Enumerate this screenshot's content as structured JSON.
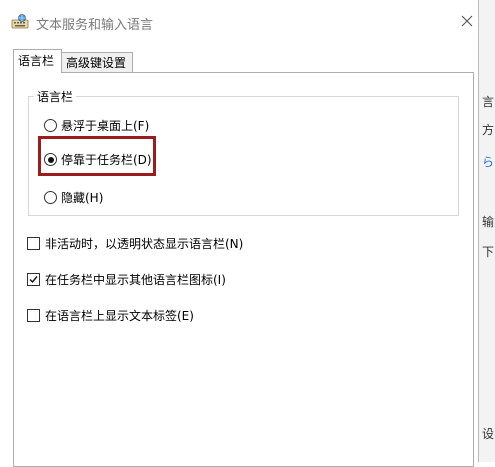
{
  "window": {
    "title": "文本服务和输入语言",
    "app_icon": "keyboard-globe-icon",
    "close_icon": "close-icon"
  },
  "tabs": [
    {
      "label": "语言栏",
      "active": true
    },
    {
      "label": "高级键设置",
      "active": false
    }
  ],
  "language_bar_group": {
    "label": "语言栏",
    "options": [
      {
        "label": "悬浮于桌面上(F)",
        "selected": false
      },
      {
        "label": "停靠于任务栏(D)",
        "selected": true
      },
      {
        "label": "隐藏(H)",
        "selected": false
      }
    ]
  },
  "checkboxes": [
    {
      "label": "非活动时，以透明状态显示语言栏(N)",
      "checked": false
    },
    {
      "label": "在任务栏中显示其他语言栏图标(I)",
      "checked": true
    },
    {
      "label": "在语言栏上显示文本标签(E)",
      "checked": false
    }
  ],
  "annotation": {
    "color": "#9e1b1b"
  },
  "background_window": {
    "fragments": [
      "言",
      "方",
      "ら",
      "输",
      "下",
      "设"
    ]
  }
}
